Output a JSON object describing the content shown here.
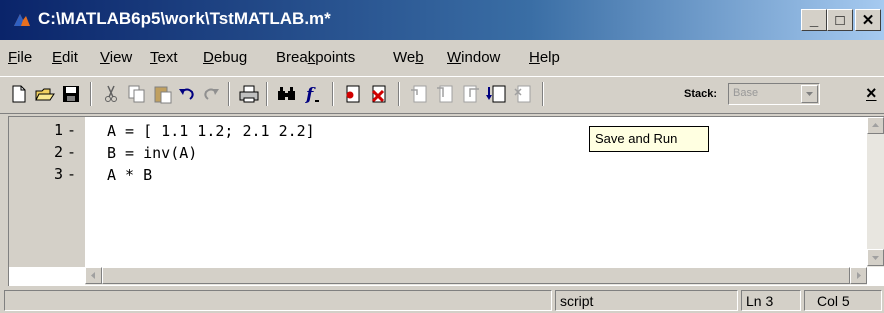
{
  "window": {
    "title": "C:\\MATLAB6p5\\work\\TstMATLAB.m*"
  },
  "window_buttons": {
    "minimize": "_",
    "maximize": "□",
    "close": "✕"
  },
  "menu": [
    {
      "pre": "",
      "ul": "F",
      "post": "ile"
    },
    {
      "pre": "",
      "ul": "E",
      "post": "dit"
    },
    {
      "pre": "",
      "ul": "V",
      "post": "iew"
    },
    {
      "pre": "",
      "ul": "T",
      "post": "ext"
    },
    {
      "pre": "",
      "ul": "D",
      "post": "ebug"
    },
    {
      "pre": "Brea",
      "ul": "k",
      "post": "points"
    },
    {
      "pre": "We",
      "ul": "b",
      "post": ""
    },
    {
      "pre": "",
      "ul": "W",
      "post": "indow"
    },
    {
      "pre": "",
      "ul": "H",
      "post": "elp"
    }
  ],
  "toolbar": {
    "buttons": [
      "new-file-icon",
      "open-folder-icon",
      "save-icon",
      "cut-icon",
      "copy-icon",
      "paste-icon",
      "undo-icon",
      "redo-icon",
      "print-icon",
      "find-icon",
      "function-icon",
      "set-breakpoint-icon",
      "clear-breakpoints-icon",
      "step-icon",
      "step-in-icon",
      "step-out-icon",
      "save-and-run-icon",
      "exit-debug-icon"
    ],
    "stack_label": "Stack:",
    "stack_value": "Base",
    "close_glyph": "×"
  },
  "editor": {
    "lines": [
      {
        "num": "1",
        "marker": "-",
        "code": "A = [ 1.1 1.2; 2.1 2.2]"
      },
      {
        "num": "2",
        "marker": "-",
        "code": "B = inv(A)"
      },
      {
        "num": "3",
        "marker": "-",
        "code": "A * B"
      }
    ],
    "tooltip": "Save and Run"
  },
  "status": {
    "mode": "script",
    "line": "Ln 3",
    "col": "Col 5"
  },
  "colors": {
    "title_gradient_start": "#0a246a",
    "title_gradient_end": "#a6caf0",
    "face": "#d4d0c8"
  }
}
